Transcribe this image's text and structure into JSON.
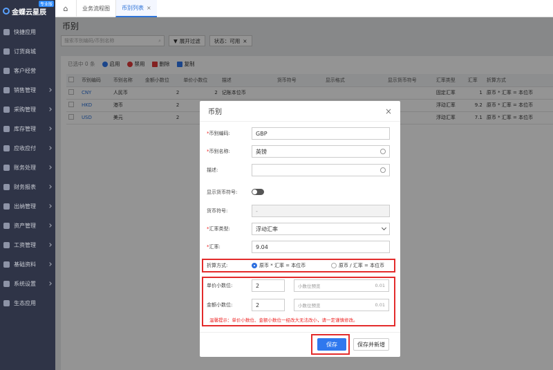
{
  "app": {
    "logo_text": "金蝶云星辰",
    "logo_badge": "专业版"
  },
  "sidebar": {
    "items": [
      {
        "label": "快捷应用"
      },
      {
        "label": "订货商城"
      },
      {
        "label": "客户经营"
      },
      {
        "label": "销售管理"
      },
      {
        "label": "采购管理"
      },
      {
        "label": "库存管理"
      },
      {
        "label": "应收应付"
      },
      {
        "label": "账务处理"
      },
      {
        "label": "财务报表"
      },
      {
        "label": "出纳管理"
      },
      {
        "label": "资产管理"
      },
      {
        "label": "工资管理"
      },
      {
        "label": "基础资料"
      },
      {
        "label": "系统设置"
      },
      {
        "label": "生态应用"
      }
    ]
  },
  "tabs": [
    {
      "label": "业务流程图"
    },
    {
      "label": "币别列表",
      "close": "×"
    }
  ],
  "page": {
    "title": "币别",
    "search_placeholder": "搜索币别编码/币别名称",
    "filter_button": "展开过滤",
    "status_filter": "状态：可用",
    "status_close": "×"
  },
  "actions": {
    "selected": "已选中 0 条",
    "enable": "启用",
    "disable": "禁用",
    "delete": "删除",
    "copy": "复制"
  },
  "table": {
    "headers": [
      "币别编码",
      "币别名称",
      "金额小数位",
      "单价小数位",
      "描述",
      "货币符号",
      "显示格式",
      "显示货币符号",
      "汇率类型",
      "汇率",
      "折算方式"
    ],
    "rows": [
      {
        "code": "CNY",
        "name": "人民币",
        "amt": "2",
        "price": "2",
        "desc": "记账本位币",
        "rate_type": "固定汇率",
        "rate": "1",
        "method": "原币 * 汇率 = 本位币"
      },
      {
        "code": "HKD",
        "name": "港币",
        "amt": "2",
        "price": "",
        "desc": "",
        "rate_type": "浮动汇率",
        "rate": "9.2",
        "method": "原币 * 汇率 = 本位币"
      },
      {
        "code": "USD",
        "name": "美元",
        "amt": "2",
        "price": "",
        "desc": "",
        "rate_type": "浮动汇率",
        "rate": "7.1",
        "method": "原币 * 汇率 = 本位币"
      }
    ]
  },
  "dialog": {
    "title": "币别",
    "close": "×",
    "code_label": "币别编码:",
    "code_value": "GBP",
    "name_label": "币别名称:",
    "name_value": "英镑",
    "desc_label": "描述:",
    "show_symbol_label": "显示货币符号:",
    "symbol_label": "货币符号:",
    "symbol_value": "-",
    "rate_type_label": "汇率类型:",
    "rate_type_value": "浮动汇率",
    "rate_label": "汇率:",
    "rate_value": "9.04",
    "method_label": "折算方式:",
    "method_option1": "原币 * 汇率 = 本位币",
    "method_option2": "原币 / 汇率 = 本位币",
    "price_decimal_label": "单价小数位:",
    "price_decimal_value": "2",
    "price_preview_placeholder": "小数位预览",
    "price_preview_value": "0.01",
    "amount_decimal_label": "金额小数位:",
    "amount_decimal_value": "2",
    "amount_preview_placeholder": "小数位预览",
    "amount_preview_value": "0.01",
    "hint": "温馨提示：单价小数位、金额小数位一经改大无法改小，请一定谨慎修改。",
    "save": "保存",
    "save_new": "保存并新增"
  },
  "colors": {
    "accent": "#2f78ee",
    "highlight": "#e32b2b",
    "sidebar": "#2f3447"
  }
}
